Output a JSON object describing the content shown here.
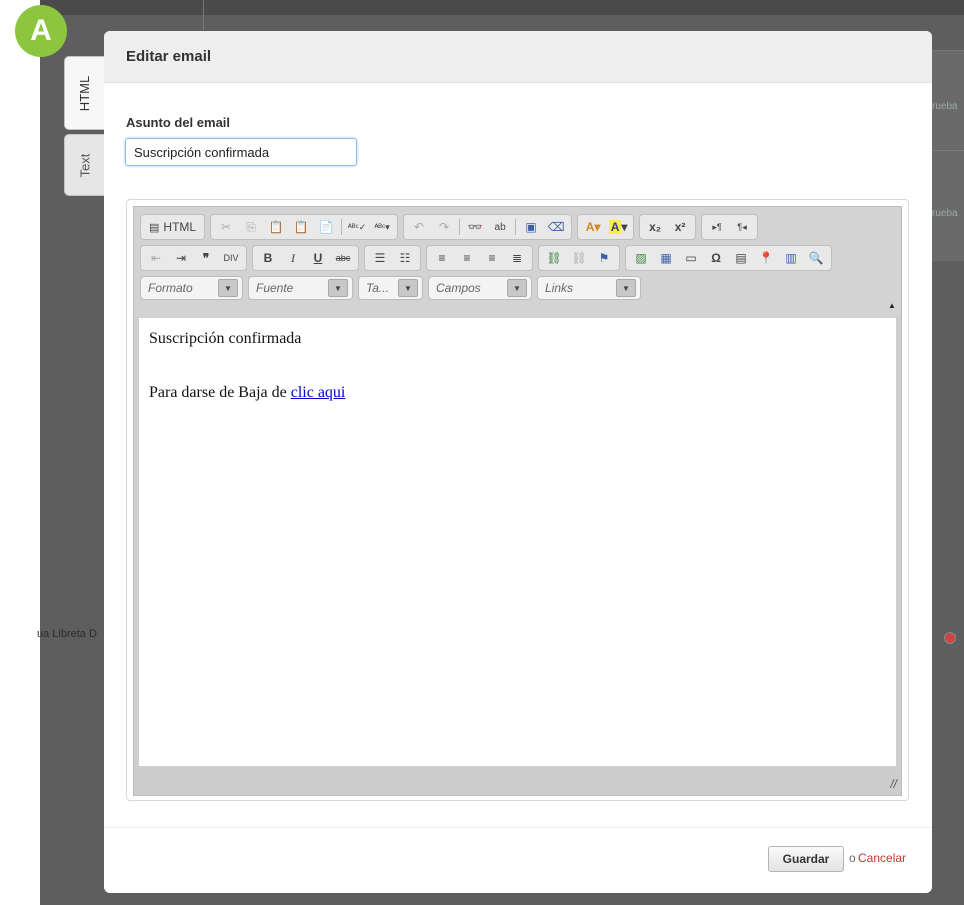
{
  "badge": {
    "letter": "A",
    "color": "#8cc63f"
  },
  "side_tabs": [
    {
      "label": "HTML",
      "active": true
    },
    {
      "label": "Text",
      "active": false
    }
  ],
  "background": {
    "left_text": "ua Libreta D",
    "right_text_1": "rueba",
    "right_text_2": "rueba",
    "flag_icon": "us-flag-icon"
  },
  "modal": {
    "title": "Editar email",
    "subject_label": "Asunto del email",
    "subject_value": "Suscripción confirmada"
  },
  "editor": {
    "source_label": "HTML",
    "toolbar_row1": [
      "cut-icon",
      "copy-icon",
      "paste-icon",
      "paste-text-icon",
      "paste-word-icon",
      "spellcheck-icon",
      "scayt-icon",
      "undo-icon",
      "redo-icon",
      "find-icon",
      "replace-icon",
      "select-all-icon",
      "remove-format-icon",
      "text-color-icon",
      "bg-color-icon",
      "subscript-icon",
      "superscript-icon",
      "bidi-ltr-icon",
      "bidi-rtl-icon"
    ],
    "toolbar_row2": [
      "outdent-icon",
      "indent-icon",
      "blockquote-icon",
      "creatediv-icon",
      "bold-icon",
      "italic-icon",
      "underline-icon",
      "strike-icon",
      "numbered-list-icon",
      "bulleted-list-icon",
      "align-left-icon",
      "align-center-icon",
      "align-right-icon",
      "align-justify-icon",
      "link-icon",
      "unlink-icon",
      "anchor-icon",
      "image-icon",
      "table-icon",
      "hr-icon",
      "special-char-icon",
      "iframe-icon",
      "map-pin-icon",
      "template-icon",
      "preview-icon"
    ],
    "combos": [
      "Formato",
      "Fuente",
      "Ta...",
      "Campos",
      "Links"
    ],
    "content": {
      "heading": "Suscripción confirmada",
      "unsubscribe_text": "Para darse de Baja de ",
      "unsubscribe_link": "clic aqui"
    }
  },
  "footer": {
    "save_label": "Guardar",
    "or_text": "o",
    "cancel_label": "Cancelar"
  },
  "colors": {
    "accent_link": "#0000cc",
    "cancel": "#c0392b",
    "badge": "#8cc63f"
  }
}
